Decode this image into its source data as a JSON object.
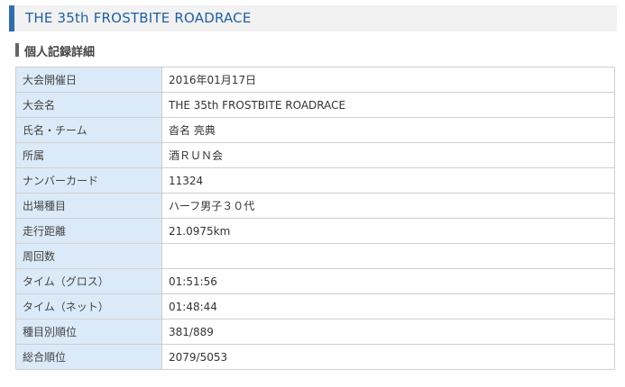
{
  "header": {
    "title": "THE 35th FROSTBITE ROADRACE"
  },
  "section": {
    "heading": "個人記録詳細"
  },
  "record_table": {
    "rows": [
      {
        "label": "大会開催日",
        "value": "2016年01月17日"
      },
      {
        "label": "大会名",
        "value": "THE 35th FROSTBITE ROADRACE"
      },
      {
        "label": "氏名・チーム",
        "value": "沓名 亮典"
      },
      {
        "label": "所属",
        "value": "酒ＲＵＮ会"
      },
      {
        "label": "ナンバーカード",
        "value": "11324"
      },
      {
        "label": "出場種目",
        "value": "ハーフ男子３０代"
      },
      {
        "label": "走行距離",
        "value": "21.0975km"
      },
      {
        "label": "周回数",
        "value": ""
      },
      {
        "label": "タイム（グロス）",
        "value": "01:51:56"
      },
      {
        "label": "タイム（ネット）",
        "value": "01:48:44"
      },
      {
        "label": "種目別順位",
        "value": "381/889"
      },
      {
        "label": "総合順位",
        "value": "2079/5053"
      }
    ]
  },
  "colors": {
    "accent": "#2e6db3",
    "title_text": "#1f5fa8",
    "label_cell_bg": "#dbeaf8",
    "border": "#cfcfcf"
  }
}
